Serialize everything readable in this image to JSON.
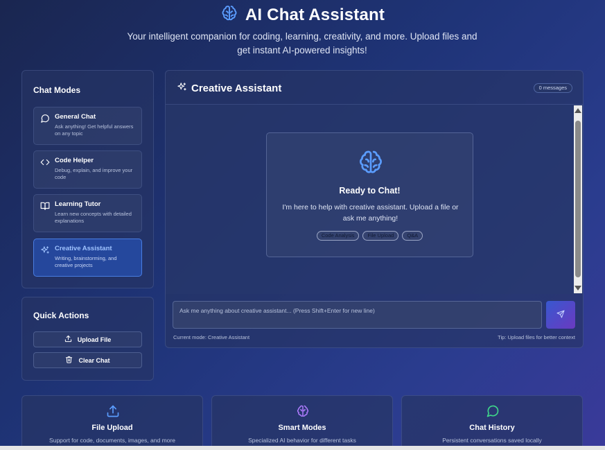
{
  "header": {
    "title": "AI Chat Assistant",
    "subtitle": "Your intelligent companion for coding, learning, creativity, and more. Upload files and get instant AI-powered insights!"
  },
  "chat_modes": {
    "title": "Chat Modes",
    "items": [
      {
        "name": "General Chat",
        "desc": "Ask anything! Get helpful answers on any topic",
        "icon": "chat-bubble-icon"
      },
      {
        "name": "Code Helper",
        "desc": "Debug, explain, and improve your code",
        "icon": "code-icon"
      },
      {
        "name": "Learning Tutor",
        "desc": "Learn new concepts with detailed explanations",
        "icon": "book-icon"
      },
      {
        "name": "Creative Assistant",
        "desc": "Writing, brainstorming, and creative projects",
        "icon": "sparkles-icon"
      }
    ],
    "active_index": 3
  },
  "quick_actions": {
    "title": "Quick Actions",
    "upload_label": "Upload File",
    "clear_label": "Clear Chat"
  },
  "chat": {
    "title": "Creative Assistant",
    "message_count": "0 messages",
    "welcome_title": "Ready to Chat!",
    "welcome_text": "I'm here to help with creative assistant. Upload a file or ask me anything!",
    "chips": [
      "Code Analysis",
      "File Upload",
      "Q&A"
    ],
    "input_placeholder": "Ask me anything about creative assistant... (Press Shift+Enter for new line)",
    "input_value": "",
    "current_mode": "Current mode: Creative Assistant",
    "tip": "Tip: Upload files for better context"
  },
  "features": [
    {
      "title": "File Upload",
      "desc": "Support for code, documents, images, and more",
      "icon": "upload-icon"
    },
    {
      "title": "Smart Modes",
      "desc": "Specialized AI behavior for different tasks",
      "icon": "brain-icon"
    },
    {
      "title": "Chat History",
      "desc": "Persistent conversations saved locally",
      "icon": "chat-bubble-icon"
    }
  ],
  "colors": {
    "accent": "#5b9dff",
    "feature_upload": "#5b9dff",
    "feature_modes": "#b07cff",
    "feature_history": "#3fd68a"
  }
}
